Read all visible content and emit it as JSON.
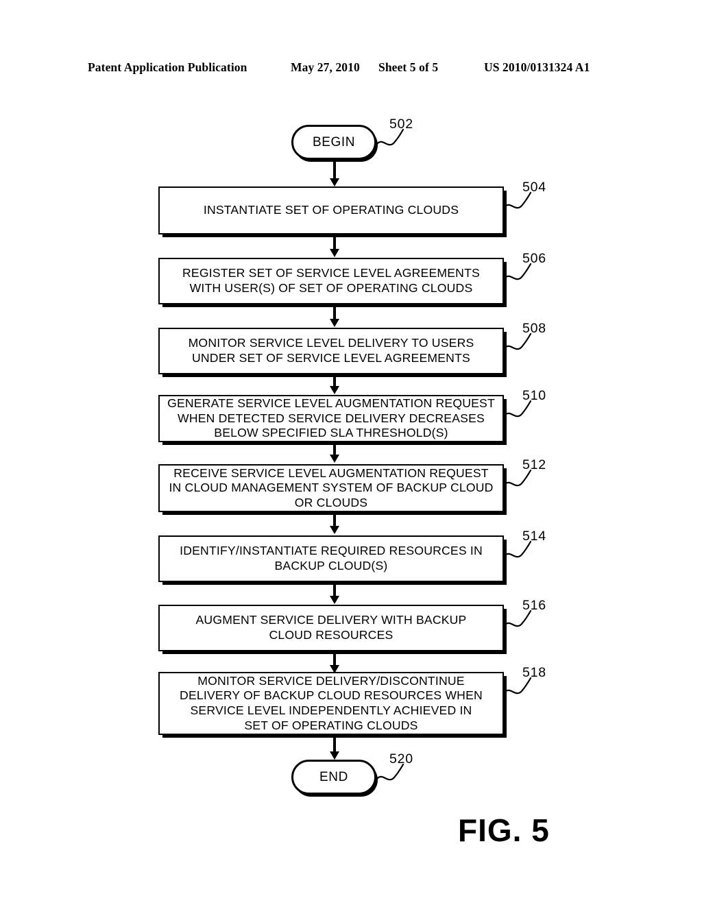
{
  "header": {
    "publication": "Patent Application Publication",
    "date": "May 27, 2010",
    "sheet": "Sheet 5 of 5",
    "doc_number": "US 2010/0131324 A1"
  },
  "figure": {
    "caption": "FIG. 5",
    "ink_color": "#000000",
    "page_background": "#ffffff"
  },
  "flow": {
    "begin": {
      "label": "BEGIN",
      "ref": "502"
    },
    "end": {
      "label": "END",
      "ref": "520"
    },
    "steps": [
      {
        "ref": "504",
        "text": "INSTANTIATE SET OF OPERATING CLOUDS"
      },
      {
        "ref": "506",
        "text": "REGISTER SET OF SERVICE LEVEL AGREEMENTS\nWITH USER(S) OF SET OF OPERATING CLOUDS"
      },
      {
        "ref": "508",
        "text": "MONITOR SERVICE LEVEL DELIVERY TO USERS\nUNDER SET OF SERVICE LEVEL AGREEMENTS"
      },
      {
        "ref": "510",
        "text": "GENERATE SERVICE LEVEL AUGMENTATION REQUEST\nWHEN DETECTED SERVICE DELIVERY DECREASES\nBELOW SPECIFIED SLA THRESHOLD(S)"
      },
      {
        "ref": "512",
        "text": "RECEIVE SERVICE LEVEL AUGMENTATION REQUEST\nIN CLOUD MANAGEMENT SYSTEM OF BACKUP CLOUD\nOR CLOUDS"
      },
      {
        "ref": "514",
        "text": "IDENTIFY/INSTANTIATE REQUIRED RESOURCES IN\nBACKUP CLOUD(S)"
      },
      {
        "ref": "516",
        "text": "AUGMENT SERVICE DELIVERY WITH BACKUP\nCLOUD RESOURCES"
      },
      {
        "ref": "518",
        "text": "MONITOR SERVICE DELIVERY/DISCONTINUE\nDELIVERY OF BACKUP CLOUD RESOURCES WHEN\nSERVICE LEVEL INDEPENDENTLY ACHIEVED IN\nSET OF OPERATING CLOUDS"
      }
    ]
  }
}
